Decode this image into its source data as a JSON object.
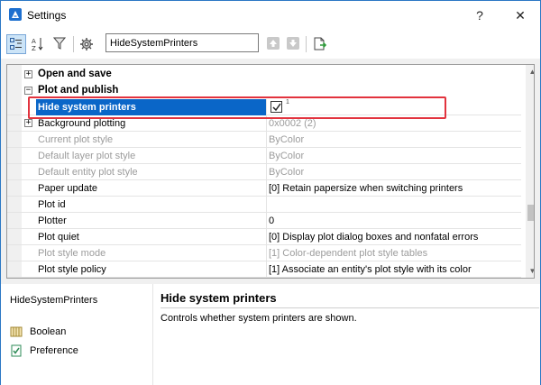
{
  "window": {
    "title": "Settings",
    "help_label": "?",
    "close_label": "✕"
  },
  "toolbar": {
    "search_value": "HideSystemPrinters",
    "sort_label_top": "A Z",
    "sort_label_bottom": "Z"
  },
  "grid": {
    "categories": [
      {
        "label": "Open and save",
        "expander": "+"
      },
      {
        "label": "Plot and publish",
        "expander": "−"
      }
    ],
    "properties": [
      {
        "name": "Hide system printers",
        "value": "",
        "checked": true,
        "mark": "1"
      },
      {
        "name": "Background plotting",
        "value": "0x0002 (2)",
        "expander": "+"
      },
      {
        "name": "Current plot style",
        "value": "ByColor"
      },
      {
        "name": "Default layer plot style",
        "value": "ByColor"
      },
      {
        "name": "Default entity plot style",
        "value": "ByColor"
      },
      {
        "name": "Paper update",
        "value": "[0] Retain papersize when switching printers"
      },
      {
        "name": "Plot id",
        "value": ""
      },
      {
        "name": "Plotter",
        "value": "0"
      },
      {
        "name": "Plot quiet",
        "value": "[0] Display plot dialog boxes and nonfatal errors"
      },
      {
        "name": "Plot style mode",
        "value": "[1] Color-dependent plot style tables"
      },
      {
        "name": "Plot style policy",
        "value": "[1] Associate an entity's plot style with its color"
      }
    ],
    "scroll_up_icon": "▲",
    "scroll_down_icon": "▼"
  },
  "info": {
    "variable_name": "HideSystemPrinters",
    "type_label": "Boolean",
    "category_label": "Preference",
    "title": "Hide system printers",
    "description": "Controls whether system printers are shown."
  },
  "colors": {
    "selection": "#0a66c8",
    "highlight_border": "#e2333e",
    "disabled_text": "#9c9c9c"
  },
  "icons": {
    "app": "bricscad-logo-icon",
    "categorized_view": "categorized-view-icon",
    "alphabetical_view": "alphabetical-sort-icon",
    "filter": "filter-icon",
    "settings_tool": "gear-tool-icon",
    "previous": "arrow-up-icon",
    "next": "arrow-down-icon",
    "export": "export-icon",
    "boolean": "boolean-icon",
    "preference": "preference-icon"
  }
}
